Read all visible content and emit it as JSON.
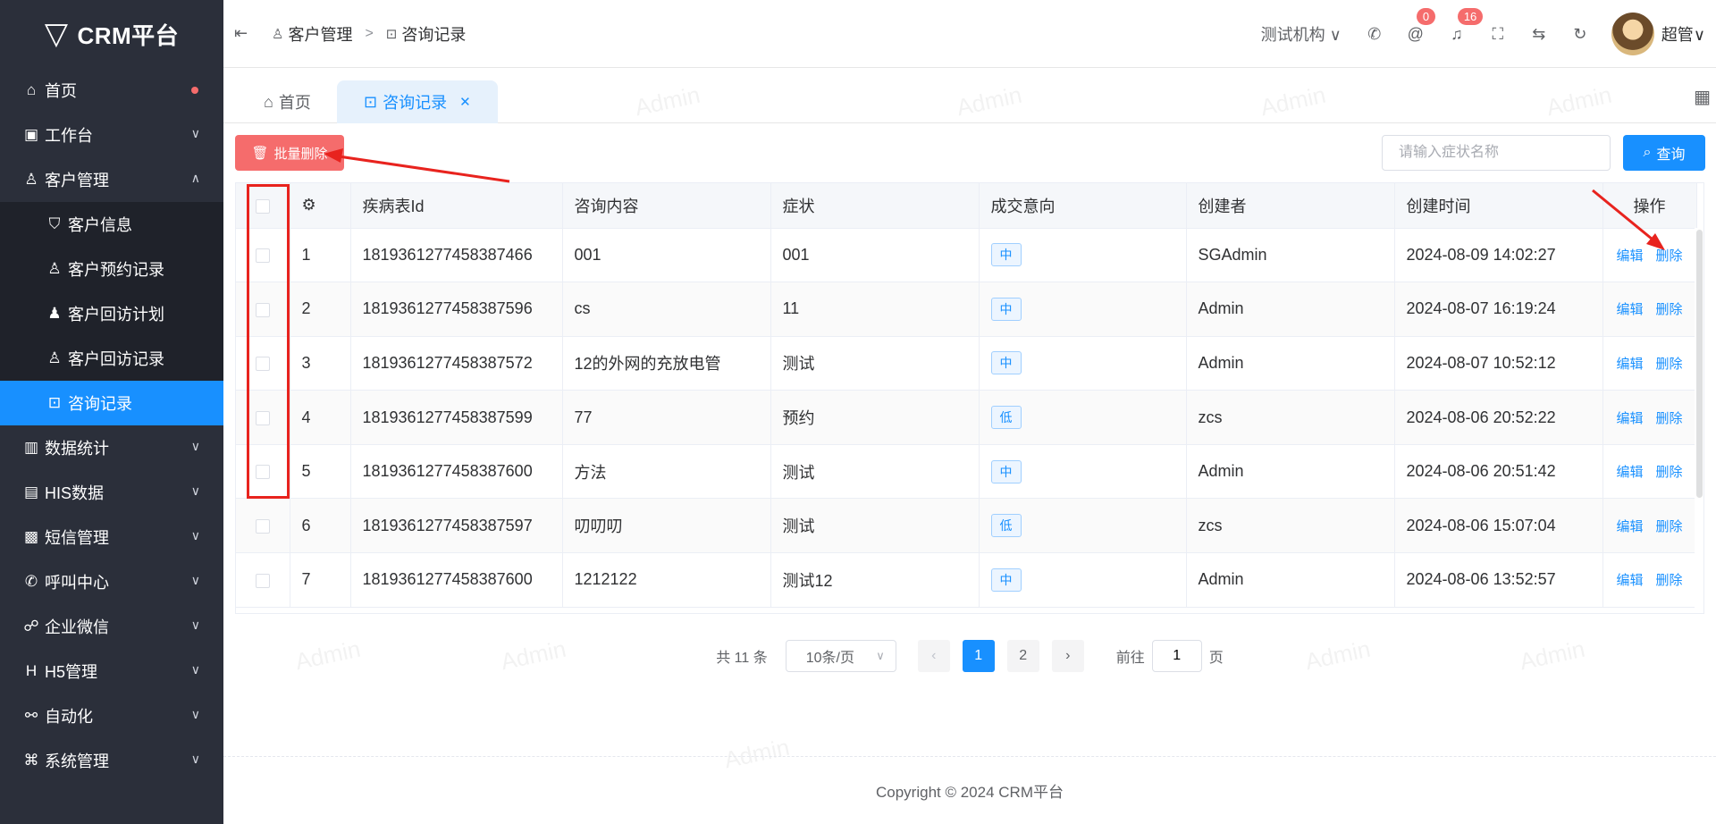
{
  "app": {
    "title": "CRM平台"
  },
  "sidebar": {
    "items": [
      {
        "label": "首页",
        "icon": "home-icon"
      },
      {
        "label": "工作台",
        "icon": "briefcase-icon"
      },
      {
        "label": "客户管理",
        "icon": "user-icon",
        "expanded": true
      },
      {
        "label": "客户信息",
        "icon": "shield-user-icon"
      },
      {
        "label": "客户预约记录",
        "icon": "user-icon"
      },
      {
        "label": "客户回访计划",
        "icon": "user-solid-icon"
      },
      {
        "label": "客户回访记录",
        "icon": "user-icon"
      },
      {
        "label": "咨询记录",
        "icon": "chat-icon",
        "active": true
      },
      {
        "label": "数据统计",
        "icon": "bar-chart-icon"
      },
      {
        "label": "HIS数据",
        "icon": "database-icon"
      },
      {
        "label": "短信管理",
        "icon": "message-icon"
      },
      {
        "label": "呼叫中心",
        "icon": "phone-icon"
      },
      {
        "label": "企业微信",
        "icon": "wechat-icon"
      },
      {
        "label": "H5管理",
        "icon": "h5-icon"
      },
      {
        "label": "自动化",
        "icon": "share-icon"
      },
      {
        "label": "系统管理",
        "icon": "grid-icon"
      }
    ]
  },
  "header": {
    "breadcrumb": [
      "客户管理",
      "咨询记录"
    ],
    "org": "测试机构",
    "at_count": "0",
    "bell_count": "16",
    "username": "超管"
  },
  "tabs": [
    {
      "label": "首页"
    },
    {
      "label": "咨询记录",
      "active": true
    }
  ],
  "toolbar": {
    "batch_delete_label": "批量删除",
    "search_placeholder": "请输入症状名称",
    "search_label": "查询"
  },
  "table": {
    "columns": [
      "疾病表Id",
      "咨询内容",
      "症状",
      "成交意向",
      "创建者",
      "创建时间",
      "操作"
    ],
    "edit_label": "编辑",
    "delete_label": "删除",
    "rows": [
      {
        "index": "1",
        "id": "1819361277458387466",
        "content": "001",
        "symptom": "001",
        "intent": "中",
        "creator": "SGAdmin",
        "created": "2024-08-09 14:02:27"
      },
      {
        "index": "2",
        "id": "1819361277458387596",
        "content": "cs",
        "symptom": "11",
        "intent": "中",
        "creator": "Admin",
        "created": "2024-08-07 16:19:24"
      },
      {
        "index": "3",
        "id": "1819361277458387572",
        "content": "12的外网的充放电管",
        "symptom": "测试",
        "intent": "中",
        "creator": "Admin",
        "created": "2024-08-07 10:52:12"
      },
      {
        "index": "4",
        "id": "1819361277458387599",
        "content": "77",
        "symptom": "预约",
        "intent": "低",
        "creator": "zcs",
        "created": "2024-08-06 20:52:22"
      },
      {
        "index": "5",
        "id": "1819361277458387600",
        "content": "方法",
        "symptom": "测试",
        "intent": "中",
        "creator": "Admin",
        "created": "2024-08-06 20:51:42"
      },
      {
        "index": "6",
        "id": "1819361277458387597",
        "content": "叨叨叨",
        "symptom": "测试",
        "intent": "低",
        "creator": "zcs",
        "created": "2024-08-06 15:07:04"
      },
      {
        "index": "7",
        "id": "1819361277458387600",
        "content": "1212122",
        "symptom": "测试12",
        "intent": "中",
        "creator": "Admin",
        "created": "2024-08-06 13:52:57"
      }
    ]
  },
  "pagination": {
    "total": "共 11 条",
    "page_size": "10条/页",
    "pages": [
      "1",
      "2"
    ],
    "goto_label": "前往",
    "goto_value": "1",
    "page_suffix": "页"
  },
  "footer": {
    "copyright": "Copyright © 2024 CRM平台"
  },
  "colors": {
    "primary": "#1890ff",
    "danger": "#f56c6c",
    "sidebar": "#2b2f3a",
    "annotation": "#e8231e"
  }
}
